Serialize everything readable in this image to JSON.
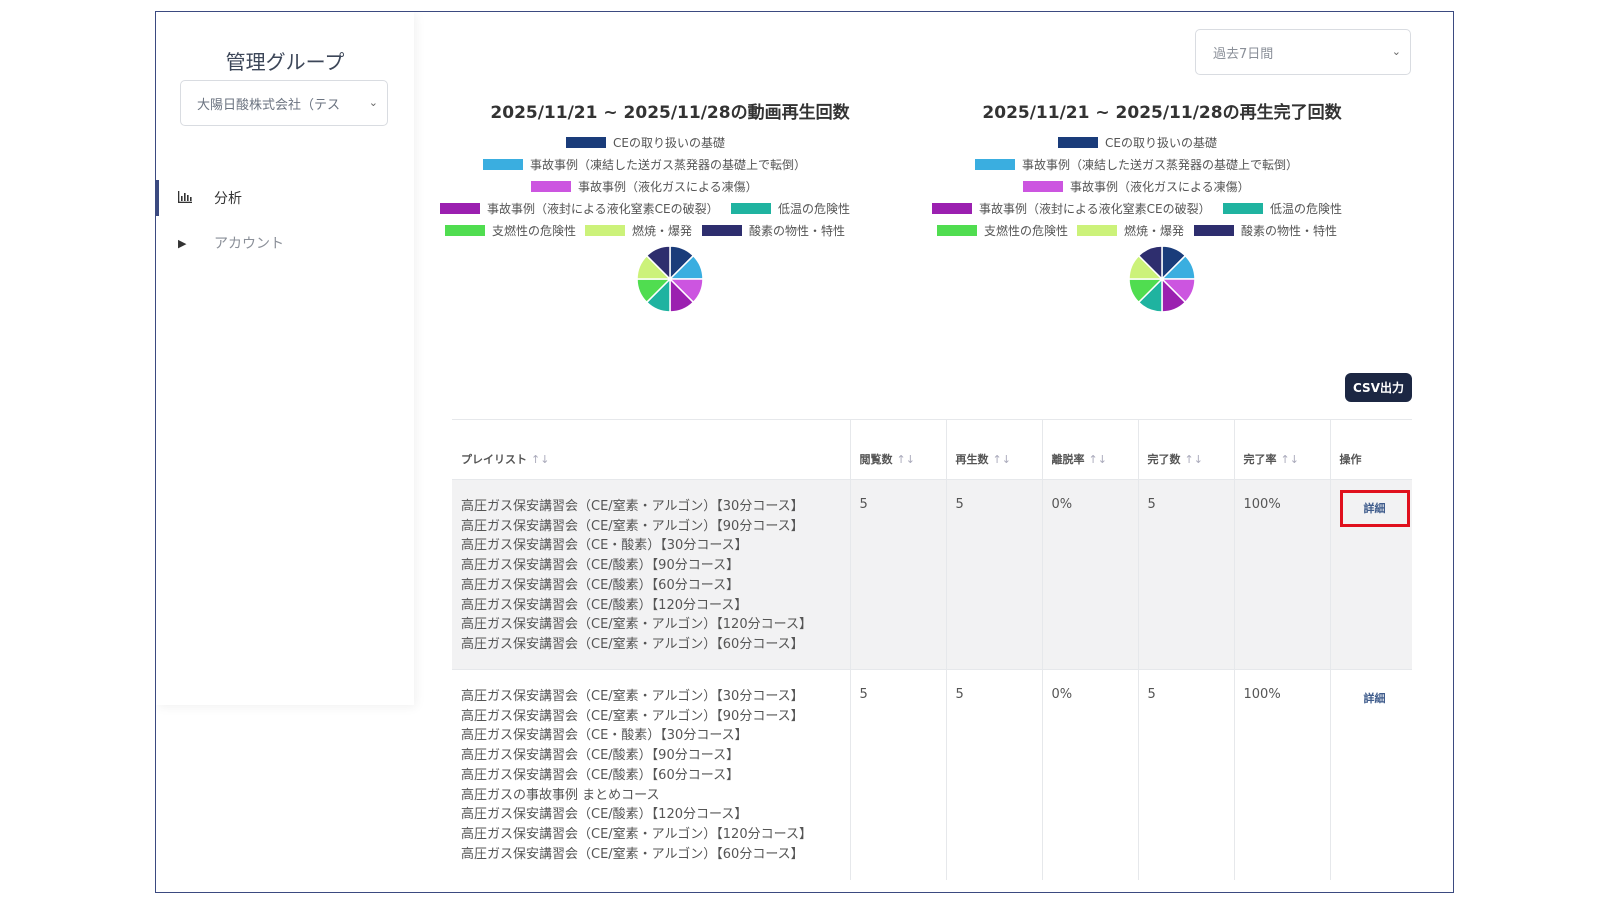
{
  "sidebar": {
    "title": "管理グループ",
    "group_select": "大陽日酸株式会社（テス",
    "items": [
      {
        "label": "分析",
        "icon": "bar-chart-icon",
        "active": true
      },
      {
        "label": "アカウント",
        "icon": "caret-right-icon",
        "active": false
      }
    ]
  },
  "period_select": "過去7日間",
  "legend_colors": [
    "#1a3c7a",
    "#3aaee0",
    "#cc55e0",
    "#9b20b0",
    "#1fb3a0",
    "#50dd50",
    "#ccf27a",
    "#2e2e6e"
  ],
  "chart_data": [
    {
      "type": "pie",
      "title": "2025/11/21 ~ 2025/11/28の動画再生回数",
      "labels": [
        "CEの取り扱いの基礎",
        "事故事例（凍結した送ガス蒸発器の基礎上で転倒）",
        "事故事例（液化ガスによる凍傷）",
        "事故事例（液封による液化窒素CEの破裂）",
        "低温の危険性",
        "支燃性の危険性",
        "燃焼・爆発",
        "酸素の物性・特性"
      ],
      "values": [
        1,
        1,
        1,
        1,
        1,
        1,
        1,
        1
      ],
      "legend": "top"
    },
    {
      "type": "pie",
      "title": "2025/11/21 ~ 2025/11/28の再生完了回数",
      "labels": [
        "CEの取り扱いの基礎",
        "事故事例（凍結した送ガス蒸発器の基礎上で転倒）",
        "事故事例（液化ガスによる凍傷）",
        "事故事例（液封による液化窒素CEの破裂）",
        "低温の危険性",
        "支燃性の危険性",
        "燃焼・爆発",
        "酸素の物性・特性"
      ],
      "values": [
        1,
        1,
        1,
        1,
        1,
        1,
        1,
        1
      ],
      "legend": "top"
    }
  ],
  "csv_button": "CSV出力",
  "table": {
    "headers": [
      "プレイリスト",
      "閲覧数",
      "再生数",
      "離脱率",
      "完了数",
      "完了率",
      "操作"
    ],
    "rows": [
      {
        "playlists": [
          "高圧ガス保安講習会（CE/窒素・アルゴン）【30分コース】",
          "高圧ガス保安講習会（CE/窒素・アルゴン）【90分コース】",
          "高圧ガス保安講習会（CE・酸素）【30分コース】",
          "高圧ガス保安講習会（CE/酸素）【90分コース】",
          "高圧ガス保安講習会（CE/酸素）【60分コース】",
          "高圧ガス保安講習会（CE/酸素）【120分コース】",
          "高圧ガス保安講習会（CE/窒素・アルゴン）【120分コース】",
          "高圧ガス保安講習会（CE/窒素・アルゴン）【60分コース】"
        ],
        "views": "5",
        "plays": "5",
        "drop_rate": "0%",
        "completions": "5",
        "completion_rate": "100%",
        "action": "詳細"
      },
      {
        "playlists": [
          "高圧ガス保安講習会（CE/窒素・アルゴン）【30分コース】",
          "高圧ガス保安講習会（CE/窒素・アルゴン）【90分コース】",
          "高圧ガス保安講習会（CE・酸素）【30分コース】",
          "高圧ガス保安講習会（CE/酸素）【90分コース】",
          "高圧ガス保安講習会（CE/酸素）【60分コース】",
          "高圧ガスの事故事例 まとめコース",
          "高圧ガス保安講習会（CE/酸素）【120分コース】",
          "高圧ガス保安講習会（CE/窒素・アルゴン）【120分コース】",
          "高圧ガス保安講習会（CE/窒素・アルゴン）【60分コース】"
        ],
        "views": "5",
        "plays": "5",
        "drop_rate": "0%",
        "completions": "5",
        "completion_rate": "100%",
        "action": "詳細"
      }
    ]
  }
}
